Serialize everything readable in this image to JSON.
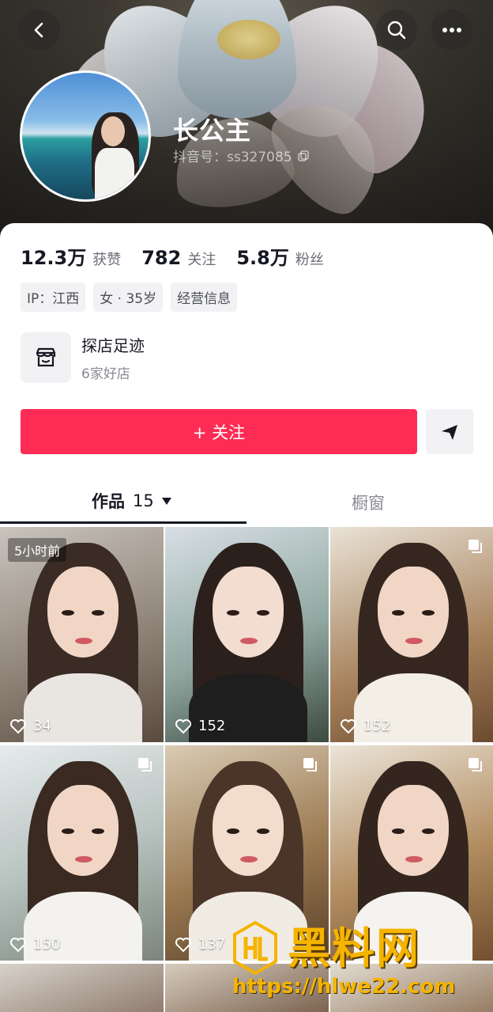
{
  "profile": {
    "name": "长公主",
    "account_id": "抖音号：ss327085"
  },
  "stats": [
    {
      "value": "12.3万",
      "label": "获赞"
    },
    {
      "value": "782",
      "label": "关注"
    },
    {
      "value": "5.8万",
      "label": "粉丝"
    }
  ],
  "tags": [
    "IP：江西",
    "女 · 35岁",
    "经营信息"
  ],
  "shop": {
    "title": "探店足迹",
    "subtitle": "6家好店",
    "icon": "store-icon"
  },
  "actions": {
    "follow_label": "+ 关注",
    "share_icon": "send-icon"
  },
  "tabs": {
    "works_label": "作品",
    "works_count": "15",
    "window_label": "橱窗"
  },
  "videos": [
    {
      "likes": "34",
      "badge": "5小时前",
      "multi": false
    },
    {
      "likes": "152",
      "badge": "",
      "multi": false
    },
    {
      "likes": "152",
      "badge": "",
      "multi": true
    },
    {
      "likes": "150",
      "badge": "",
      "multi": true
    },
    {
      "likes": "137",
      "badge": "",
      "multi": true
    },
    {
      "likes": "",
      "badge": "",
      "multi": true
    }
  ],
  "watermark": {
    "title": "黑料网",
    "url": "https://hlwe22.com"
  },
  "colors": {
    "accent": "#fe2c55",
    "text_primary": "#161823",
    "text_secondary": "#8a8b91",
    "chip_bg": "#f2f2f4",
    "watermark": "#f5b400"
  }
}
